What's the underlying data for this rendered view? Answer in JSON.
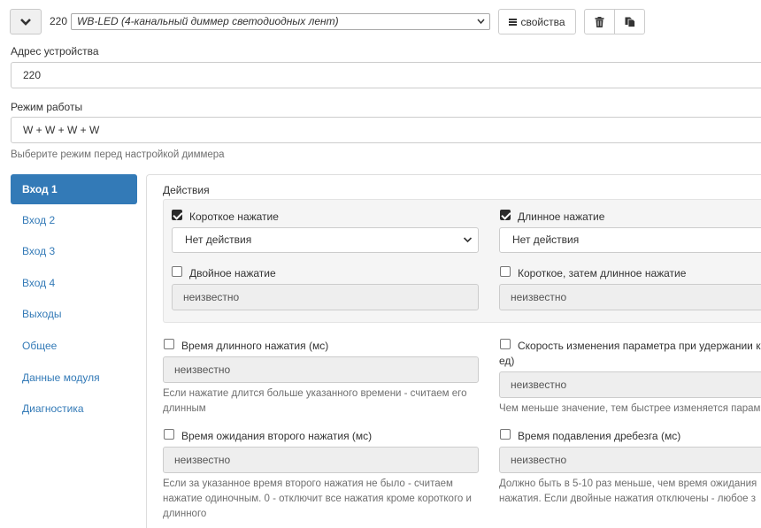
{
  "toolbar": {
    "device_number": "220",
    "device_select": "WB-LED (4-канальный диммер светодиодных лент)",
    "properties_label": "свойства"
  },
  "address": {
    "label": "Адрес устройства",
    "value": "220"
  },
  "mode": {
    "label": "Режим работы",
    "value": "W + W + W + W",
    "hint": "Выберите режим перед настройкой диммера"
  },
  "nav": {
    "items": [
      {
        "label": "Вход 1",
        "active": true
      },
      {
        "label": "Вход 2"
      },
      {
        "label": "Вход 3"
      },
      {
        "label": "Вход 4"
      },
      {
        "label": "Выходы"
      },
      {
        "label": "Общее"
      },
      {
        "label": "Данные модуля"
      },
      {
        "label": "Диагностика"
      }
    ]
  },
  "actions": {
    "title": "Действия",
    "short_press": {
      "label": "Короткое нажатие",
      "checked": true,
      "value": "Нет действия"
    },
    "long_press": {
      "label": "Длинное нажатие",
      "checked": true,
      "value": "Нет действия"
    },
    "double_press": {
      "label": "Двойное нажатие",
      "checked": false,
      "value": "неизвестно"
    },
    "short_then_long": {
      "label": "Короткое, затем длинное нажатие",
      "checked": false,
      "value": "неизвестно"
    }
  },
  "settings": {
    "long_press_time": {
      "label": "Время длинного нажатия (мс)",
      "value": "неизвестно",
      "hint_line1": "Если нажатие длится больше указанного времени - считаем его",
      "hint_line2": "длинным"
    },
    "change_speed": {
      "label_line1": "Скорость изменения параметра при удержании кно",
      "label_line2": "ед)",
      "value": "неизвестно",
      "hint": "Чем меньше значение, тем быстрее изменяется парам"
    },
    "second_press_wait": {
      "label": "Время ожидания второго нажатия (мс)",
      "value": "неизвестно",
      "hint_line1": "Если за указанное время второго нажатия не было - считаем",
      "hint_line2": "нажатие одиночным. 0 - отключит все нажатия кроме короткого и",
      "hint_line3": "длинного"
    },
    "debounce": {
      "label": "Время подавления дребезга (мс)",
      "value": "неизвестно",
      "hint_line1": "Должно быть в 5-10 раз меньше, чем время ожидания",
      "hint_line2": "нажатия. Если двойные нажатия отключены - любое з"
    }
  },
  "icons": {
    "collapse": "chevron-down-icon",
    "select_caret": "chevron-down-icon",
    "properties": "list-icon",
    "delete": "trash-icon",
    "copy": "copy-icon"
  },
  "colors": {
    "accent": "#337ab7",
    "readonly_bg": "#eeeeee",
    "well_bg": "#f5f5f5"
  }
}
